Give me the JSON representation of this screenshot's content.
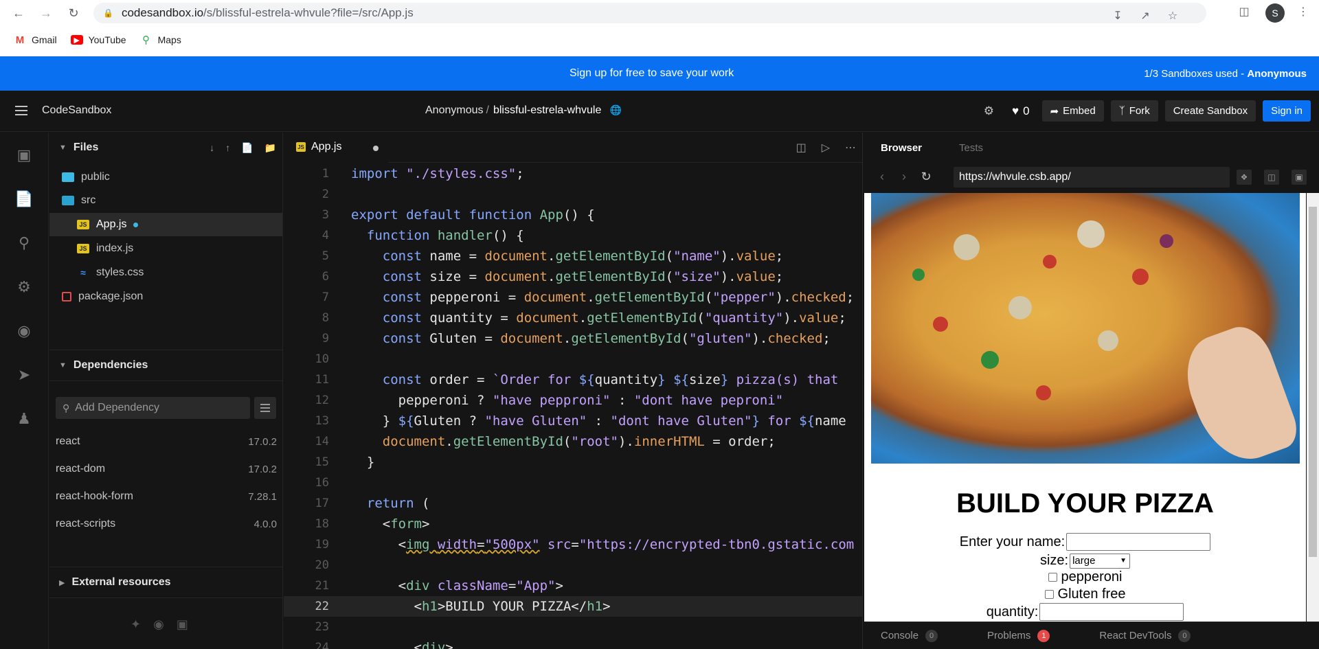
{
  "browser": {
    "url_host": "codesandbox.io",
    "url_path": "/s/blissful-estrela-whvule?file=/src/App.js",
    "profile_initial": "S",
    "bookmarks": [
      {
        "label": "Gmail",
        "icon": "gmail-icon"
      },
      {
        "label": "YouTube",
        "icon": "youtube-icon"
      },
      {
        "label": "Maps",
        "icon": "maps-icon"
      }
    ]
  },
  "banner": {
    "center_text": "Sign up for free to save your work",
    "usage_text": "1/3 Sandboxes used - ",
    "usage_user": "Anonymous"
  },
  "header": {
    "logo": "CodeSandbox",
    "owner": "Anonymous",
    "separator": "/",
    "sandbox_name": "blissful-estrela-whvule",
    "likes": "0",
    "embed_label": "Embed",
    "fork_label": "Fork",
    "create_label": "Create Sandbox",
    "signin_label": "Sign in"
  },
  "sidebar": {
    "files_title": "Files",
    "tree": [
      {
        "label": "public",
        "type": "folder"
      },
      {
        "label": "src",
        "type": "folder-open"
      },
      {
        "label": "App.js",
        "type": "js",
        "active": true
      },
      {
        "label": "index.js",
        "type": "js"
      },
      {
        "label": "styles.css",
        "type": "css"
      },
      {
        "label": "package.json",
        "type": "pkg"
      }
    ],
    "dependencies_title": "Dependencies",
    "add_dependency_placeholder": "Add Dependency",
    "dependencies": [
      {
        "name": "react",
        "version": "17.0.2"
      },
      {
        "name": "react-dom",
        "version": "17.0.2"
      },
      {
        "name": "react-hook-form",
        "version": "7.28.1"
      },
      {
        "name": "react-scripts",
        "version": "4.0.0"
      }
    ],
    "external_title": "External resources"
  },
  "editor": {
    "tab_label": "App.js",
    "current_line": 22,
    "lines": [
      "1",
      "2",
      "3",
      "4",
      "5",
      "6",
      "7",
      "8",
      "9",
      "10",
      "11",
      "12",
      "13",
      "14",
      "15",
      "16",
      "17",
      "18",
      "19",
      "20",
      "21",
      "22",
      "23",
      "24"
    ]
  },
  "preview": {
    "tab_browser": "Browser",
    "tab_tests": "Tests",
    "url": "https://whvule.csb.app/",
    "heading": "BUILD YOUR PIZZA",
    "name_label": "Enter your name:",
    "size_label": "size:",
    "size_value": "large",
    "pepperoni_label": "pepperoni",
    "gluten_label": "Gluten free",
    "quantity_label": "quantity:",
    "console_tabs": [
      {
        "label": "Console",
        "count": "0"
      },
      {
        "label": "Problems",
        "count": "1"
      },
      {
        "label": "React DevTools",
        "count": "0"
      }
    ]
  }
}
